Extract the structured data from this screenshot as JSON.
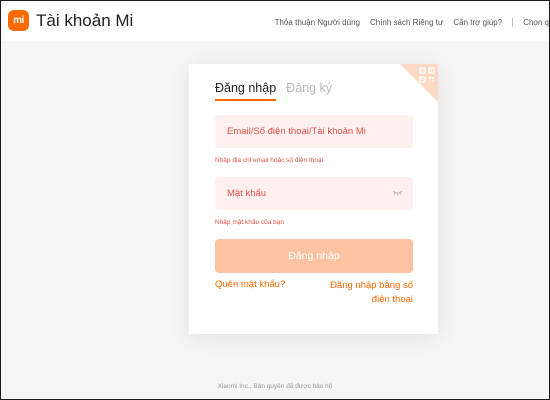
{
  "header": {
    "logo_text": "mi",
    "title": "Tài khoản Mi",
    "nav": [
      "Thỏa thuận Người dùng",
      "Chính sách Riêng tư",
      "Cần trợ giúp?",
      "Chọn q"
    ]
  },
  "login": {
    "tabs": [
      "Đăng nhập",
      "Đăng ký"
    ],
    "account_placeholder": "Email/Số điện thoại/Tài khoản Mi",
    "account_error": "Nhập địa chỉ email hoặc số điện thoại",
    "password_placeholder": "Mật khẩu",
    "password_error": "Nhập mật khẩu của bạn",
    "submit_label": "Đăng nhập",
    "forgot_label": "Quên mật khẩu?",
    "phone_login_label": "Đăng nhập bằng số điện thoại"
  },
  "footer": {
    "copyright": "Xiaomi Inc., Bản quyền đã được bảo hộ"
  },
  "colors": {
    "brand": "#ff6900",
    "error": "#e4504a",
    "field_bg": "#fdf0ef",
    "button_bg": "#fcc3a3"
  },
  "icons": {
    "qr": "qr-code-icon",
    "password_toggle": "eye-hidden-icon"
  }
}
